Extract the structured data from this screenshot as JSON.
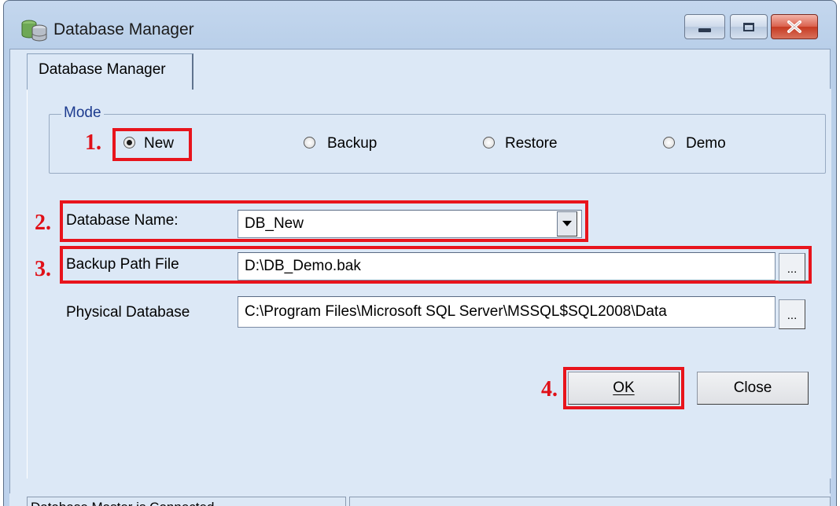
{
  "window": {
    "title": "Database Manager"
  },
  "tabs": [
    {
      "label": "Database Manager"
    }
  ],
  "mode": {
    "legend": "Mode",
    "options": [
      {
        "label": "New",
        "selected": true
      },
      {
        "label": "Backup",
        "selected": false
      },
      {
        "label": "Restore",
        "selected": false
      },
      {
        "label": "Demo",
        "selected": false
      }
    ]
  },
  "steps": [
    "1.",
    "2.",
    "3.",
    "4."
  ],
  "fields": {
    "database_name": {
      "label": "Database Name:",
      "value": "DB_New"
    },
    "backup_path": {
      "label": "Backup Path File",
      "value": "D:\\DB_Demo.bak",
      "browse": "..."
    },
    "physical_db": {
      "label": "Physical Database",
      "value": "C:\\Program Files\\Microsoft SQL Server\\MSSQL$SQL2008\\Data",
      "browse": "..."
    }
  },
  "buttons": {
    "ok": "OK",
    "close": "Close"
  },
  "status": {
    "message": "Database Master is Connected"
  },
  "colors": {
    "highlight": "#e8141c",
    "step_text": "#e01018",
    "legend_text": "#1d3b8f"
  }
}
